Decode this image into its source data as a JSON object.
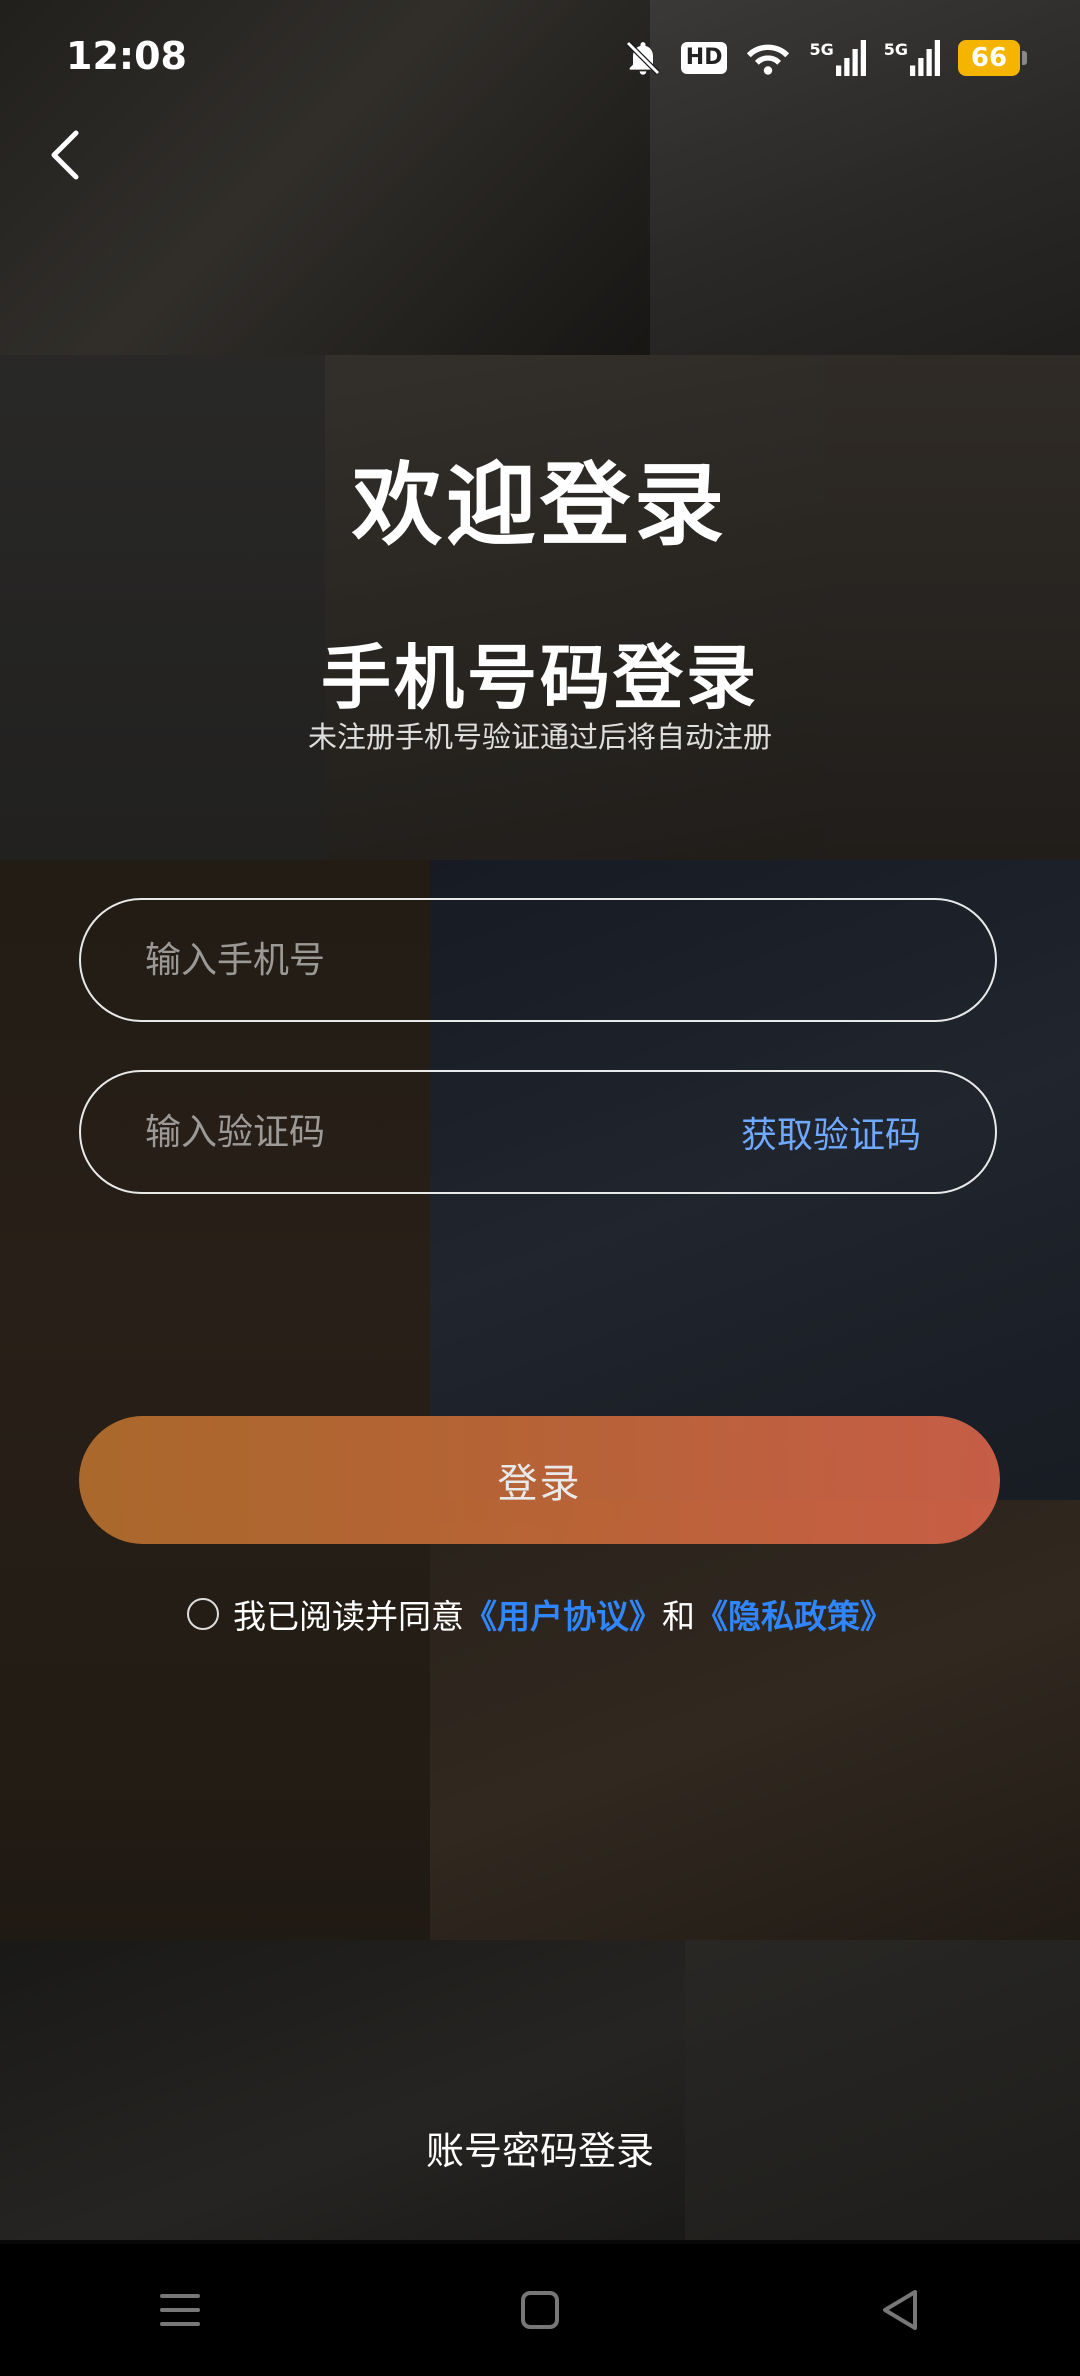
{
  "status_bar": {
    "time": "12:08",
    "icons": [
      "bell-off-icon",
      "hd-icon",
      "wifi-icon",
      "signal-5g-icon",
      "signal-5g-icon",
      "battery-icon"
    ],
    "hd_label": "HD",
    "signal1_label": "5G",
    "signal2_label": "5G",
    "battery_level": "66",
    "battery_color": "#f4b400"
  },
  "header": {
    "back_icon": "chevron-left-icon"
  },
  "welcome_title": "欢迎登录",
  "section": {
    "title": "手机号码登录",
    "subtitle": "未注册手机号验证通过后将自动注册"
  },
  "form": {
    "phone_placeholder": "输入手机号",
    "phone_value": "",
    "code_placeholder": "输入验证码",
    "code_value": "",
    "get_code_label": "获取验证码",
    "login_label": "登录"
  },
  "agreement": {
    "checked": false,
    "prefix": "我已阅读并同意",
    "user_agreement": "《用户协议》",
    "conjunction": "和",
    "privacy_policy": "《隐私政策》"
  },
  "alt_login": {
    "label": "账号密码登录"
  },
  "colors": {
    "link": "#2f86ff",
    "get_code": "#6ea8ff",
    "login_gradient_start": "#b8702e",
    "login_gradient_end": "#d9644a"
  },
  "nav": {
    "items": [
      "menu-icon",
      "home-square-icon",
      "back-triangle-icon"
    ]
  }
}
